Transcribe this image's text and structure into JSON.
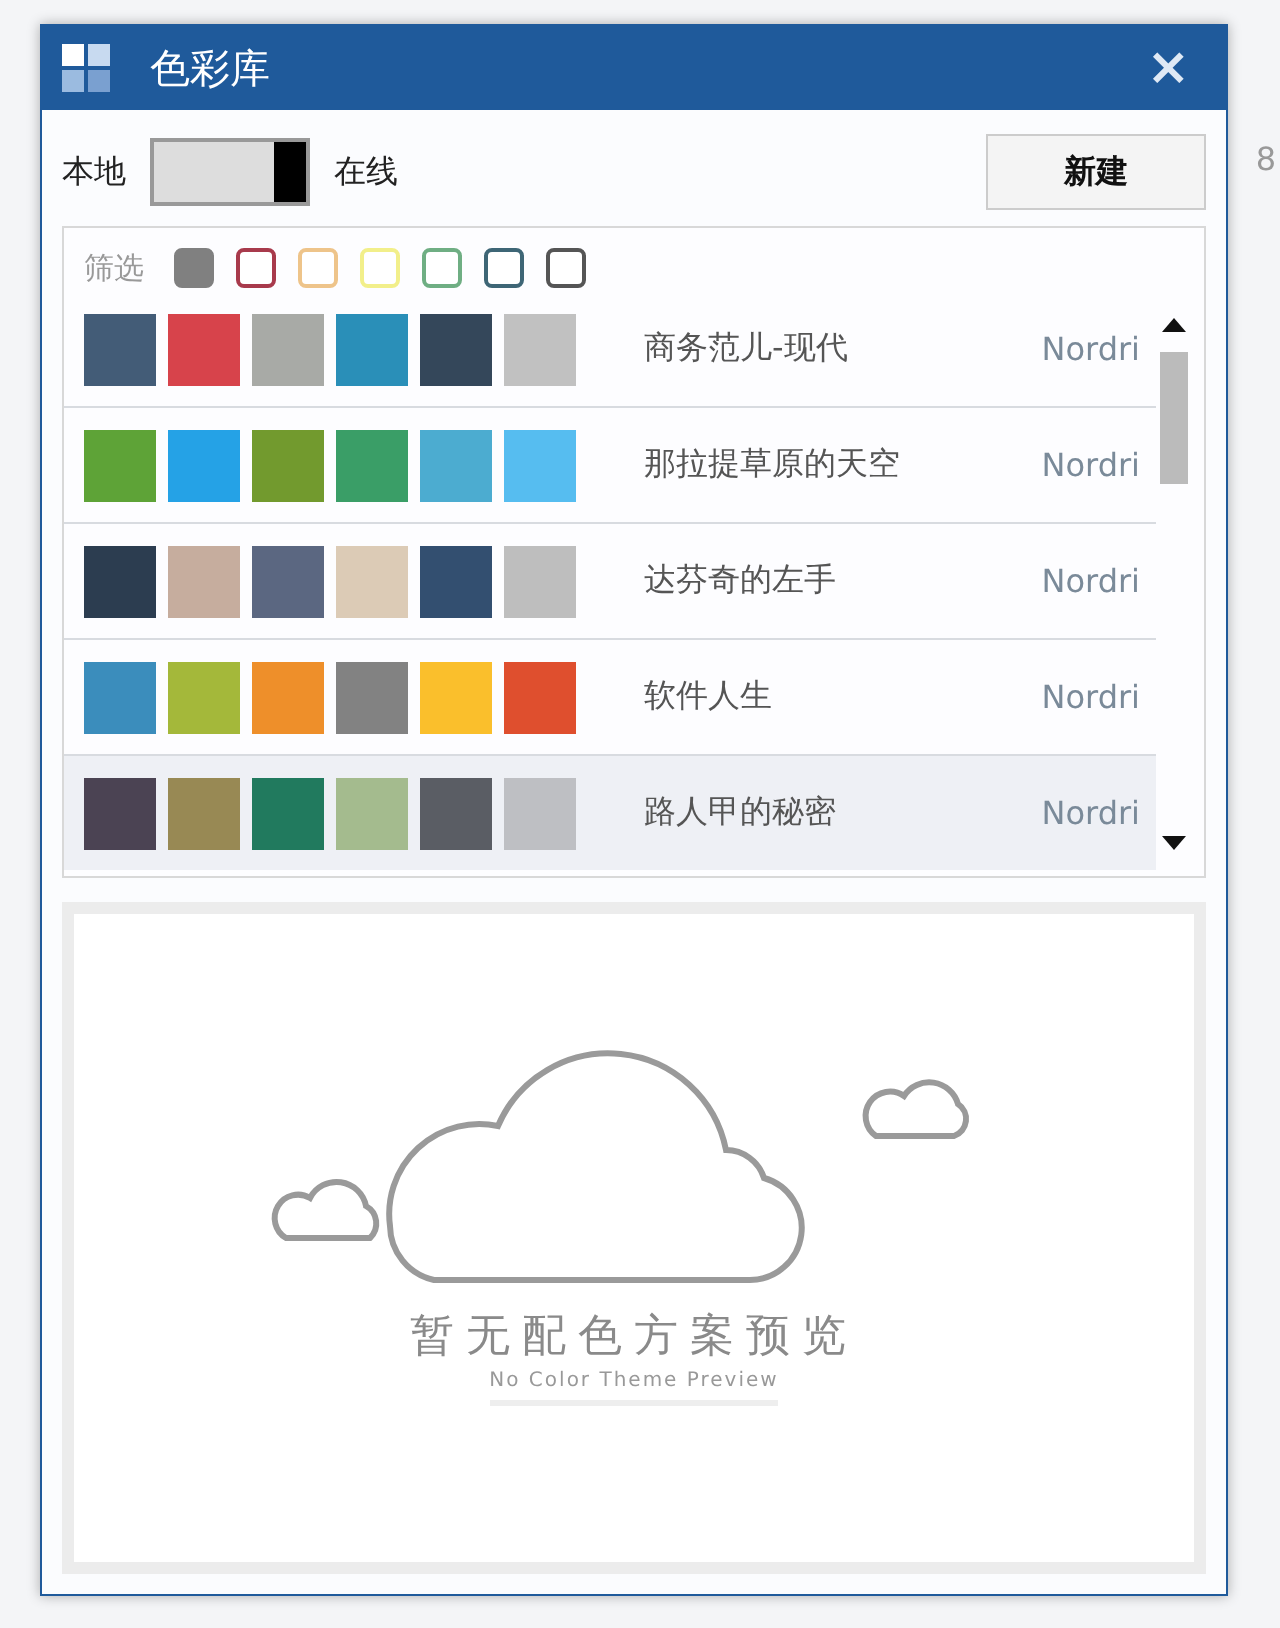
{
  "background": {
    "text": "8"
  },
  "window": {
    "title": "色彩库",
    "close": "×"
  },
  "toolbar": {
    "left_label": "本地",
    "switch": {
      "on": true
    },
    "right_label": "在线",
    "new_button": "新建"
  },
  "filter": {
    "label": "筛选",
    "swatches": [
      {
        "color": "#808080",
        "selected": true
      },
      {
        "color": "#a83a4c",
        "selected": false
      },
      {
        "color": "#eec48a",
        "selected": false
      },
      {
        "color": "#f2ef8a",
        "selected": false
      },
      {
        "color": "#6fae83",
        "selected": false
      },
      {
        "color": "#3e6676",
        "selected": false
      },
      {
        "color": "#555555",
        "selected": false
      }
    ]
  },
  "themes": [
    {
      "name": "商务范儿-现代",
      "author": "Nordri",
      "selected": false,
      "swatches": [
        {
          "color": "#435c77"
        },
        {
          "color": "#d7434b"
        },
        {
          "color": "#a8aaa6"
        },
        {
          "color": "#2a8fb8"
        },
        {
          "color": "#34475a"
        },
        {
          "color": "#c1c1c1"
        }
      ]
    },
    {
      "name": "那拉提草原的天空",
      "author": "Nordri",
      "selected": false,
      "swatches": [
        {
          "color": "#5ea337"
        },
        {
          "color": "#25a2e6"
        },
        {
          "color": "#729a2e"
        },
        {
          "color": "#3a9e67"
        },
        {
          "color": "#4cacd0"
        },
        {
          "color": "#56bdf0"
        }
      ]
    },
    {
      "name": "达芬奇的左手",
      "author": "Nordri",
      "selected": false,
      "swatches": [
        {
          "color": "#2c3d50"
        },
        {
          "color": "#c6ad9e"
        },
        {
          "color": "#5b6781"
        },
        {
          "color": "#dccbb6"
        },
        {
          "color": "#334f70"
        },
        {
          "color": "#bebebe"
        }
      ]
    },
    {
      "name": "软件人生",
      "author": "Nordri",
      "selected": false,
      "swatches": [
        {
          "color": "#3b8dbc"
        },
        {
          "color": "#a4b83a"
        },
        {
          "color": "#ee8f2a"
        },
        {
          "color": "#828282"
        },
        {
          "color": "#fabf2c"
        },
        {
          "color": "#df4f2e"
        }
      ]
    },
    {
      "name": "路人甲的秘密",
      "author": "Nordri",
      "selected": true,
      "swatches": [
        {
          "color": "#4b4353"
        },
        {
          "color": "#988954"
        },
        {
          "color": "#217a5e"
        },
        {
          "color": "#a4bb8e"
        },
        {
          "color": "#5a5d64"
        },
        {
          "color": "#bebfc3"
        }
      ]
    }
  ],
  "preview": {
    "title": "暂无配色方案预览",
    "subtitle": "No Color Theme Preview"
  }
}
